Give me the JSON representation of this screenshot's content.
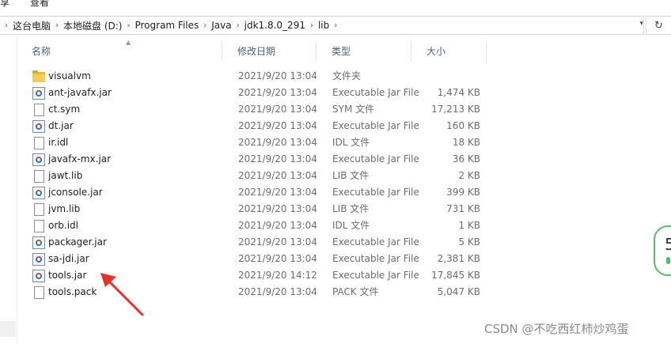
{
  "menu": {
    "items": [
      "享",
      "查看"
    ]
  },
  "address": {
    "crumbs": [
      "这台电脑",
      "本地磁盘 (D:)",
      "Program Files",
      "Java",
      "jdk1.8.0_291",
      "lib"
    ]
  },
  "columns": {
    "name": "名称",
    "modified": "修改日期",
    "type": "类型",
    "size": "大小"
  },
  "files": [
    {
      "icon": "folder-icon",
      "name": "visualvm",
      "modified": "2021/9/20 13:04",
      "type": "文件夹",
      "size": ""
    },
    {
      "icon": "jar-icon",
      "name": "ant-javafx.jar",
      "modified": "2021/9/20 13:04",
      "type": "Executable Jar File",
      "size": "1,474 KB"
    },
    {
      "icon": "file-icon",
      "name": "ct.sym",
      "modified": "2021/9/20 13:04",
      "type": "SYM 文件",
      "size": "17,213 KB"
    },
    {
      "icon": "jar-icon",
      "name": "dt.jar",
      "modified": "2021/9/20 13:04",
      "type": "Executable Jar File",
      "size": "160 KB"
    },
    {
      "icon": "file-icon",
      "name": "ir.idl",
      "modified": "2021/9/20 13:04",
      "type": "IDL 文件",
      "size": "18 KB"
    },
    {
      "icon": "jar-icon",
      "name": "javafx-mx.jar",
      "modified": "2021/9/20 13:04",
      "type": "Executable Jar File",
      "size": "36 KB"
    },
    {
      "icon": "file-icon",
      "name": "jawt.lib",
      "modified": "2021/9/20 13:04",
      "type": "LIB 文件",
      "size": "2 KB"
    },
    {
      "icon": "jar-icon",
      "name": "jconsole.jar",
      "modified": "2021/9/20 13:04",
      "type": "Executable Jar File",
      "size": "399 KB"
    },
    {
      "icon": "file-icon",
      "name": "jvm.lib",
      "modified": "2021/9/20 13:04",
      "type": "LIB 文件",
      "size": "731 KB"
    },
    {
      "icon": "file-icon",
      "name": "orb.idl",
      "modified": "2021/9/20 13:04",
      "type": "IDL 文件",
      "size": "1 KB"
    },
    {
      "icon": "jar-icon",
      "name": "packager.jar",
      "modified": "2021/9/20 13:04",
      "type": "Executable Jar File",
      "size": "5 KB"
    },
    {
      "icon": "jar-icon",
      "name": "sa-jdi.jar",
      "modified": "2021/9/20 13:04",
      "type": "Executable Jar File",
      "size": "2,381 KB"
    },
    {
      "icon": "jar-icon",
      "name": "tools.jar",
      "modified": "2021/9/20 14:12",
      "type": "Executable Jar File",
      "size": "17,845 KB"
    },
    {
      "icon": "file-icon",
      "name": "tools.pack",
      "modified": "2021/9/20 13:04",
      "type": "PACK 文件",
      "size": "5,047 KB"
    }
  ],
  "watermark": "CSDN @不吃西红柿炒鸡蛋",
  "badge": {
    "text": "5"
  },
  "colors": {
    "header_text": "#4c607a",
    "arrow": "#e8312a",
    "badge": "#4fbf6a"
  }
}
